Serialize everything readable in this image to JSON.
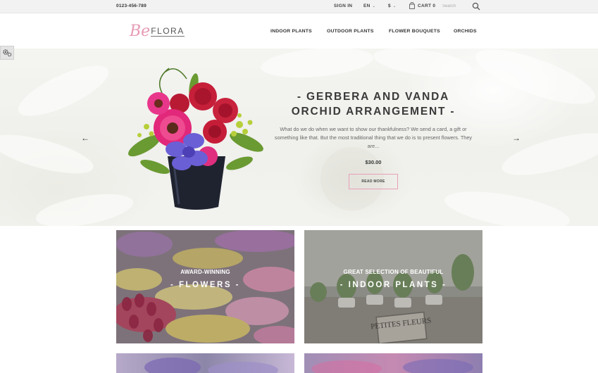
{
  "topbar": {
    "phone": "0123-456-789",
    "sign_in": "SIGN IN",
    "language": "EN",
    "currency": "$",
    "cart": "CART 0",
    "search_placeholder": "Search"
  },
  "header": {
    "logo_script": "Be",
    "logo_text": "FLORA",
    "nav": [
      "INDOOR PLANTS",
      "OUTDOOR PLANTS",
      "FLOWER BOUQUETS",
      "ORCHIDS"
    ]
  },
  "hero": {
    "title_line1": "- GERBERA AND VANDA",
    "title_line2": "ORCHID ARRANGEMENT -",
    "description": "What do we do when we want to show our thankfulness? We send a card, a gift or something like that. But the most traditional thing that we do is to present flowers. They are...",
    "price": "$30.00",
    "button": "READ MORE",
    "prev_arrow": "←",
    "next_arrow": "→"
  },
  "banners": [
    {
      "subtitle": "AWARD-WINNING",
      "title": "- FLOWERS -"
    },
    {
      "subtitle": "GREAT SELECTION OF BEAUTIFUL",
      "title": "- INDOOR PLANTS -",
      "sign": "PETITES FLEURS"
    }
  ],
  "colors": {
    "accent_pink": "#e79bb3",
    "topbar_bg": "#f2f2f2"
  }
}
